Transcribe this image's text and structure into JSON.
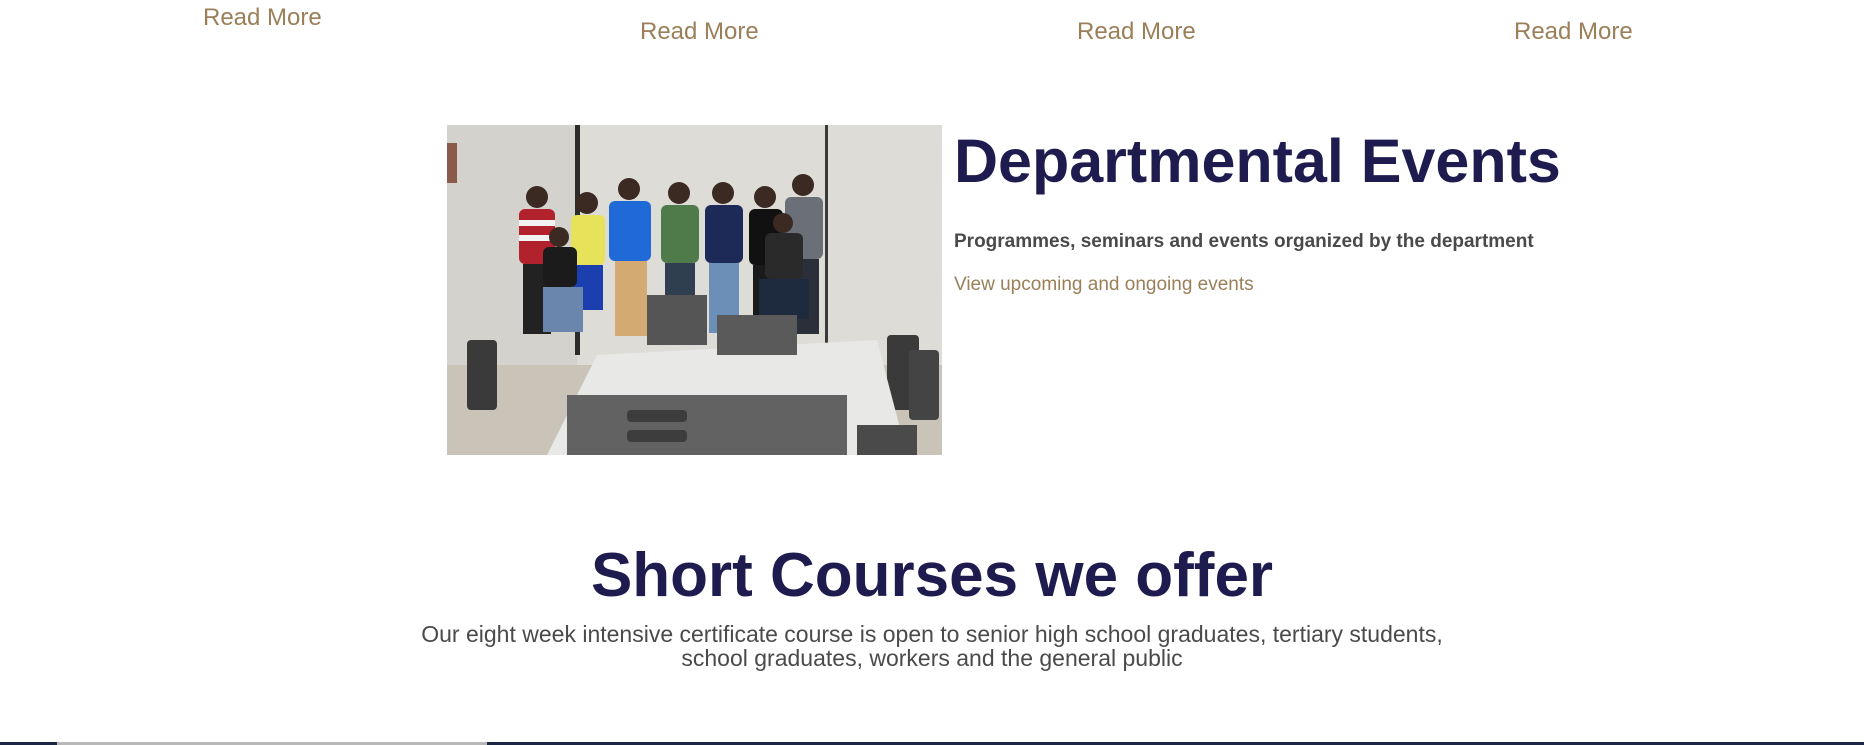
{
  "read_more": {
    "labels": [
      "Read More",
      "Read More",
      "Read More",
      "Read More"
    ]
  },
  "events": {
    "title": "Departmental Events",
    "description": "Programmes, seminars and events organized by the department",
    "link_label": "View upcoming and ongoing events",
    "photo_label": "Group photo of students in a computer lab"
  },
  "courses": {
    "title": "Short Courses we offer",
    "description_line1": "Our eight week intensive certificate course is open to senior high school graduates, tertiary students,",
    "description_line2": "school graduates, workers and the general public"
  },
  "colors": {
    "heading": "#1e1c4f",
    "accent_link": "#9a7f58",
    "body_text": "#4a4a4a"
  }
}
